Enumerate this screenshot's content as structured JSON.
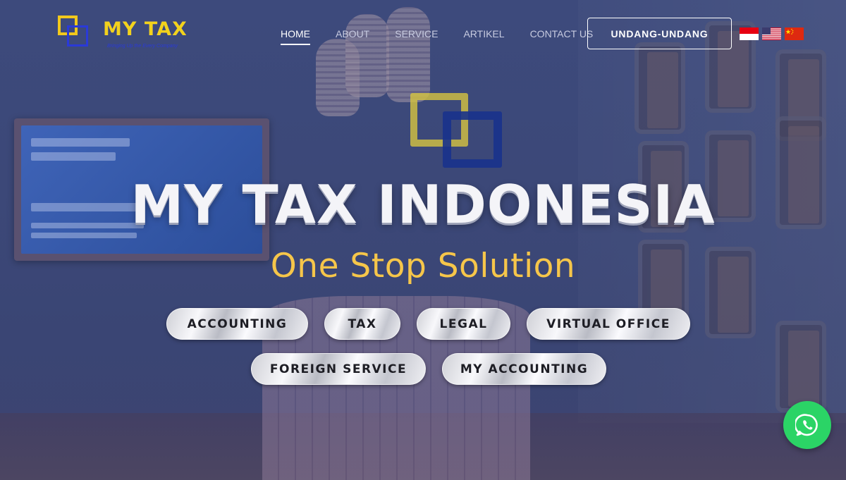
{
  "brand": {
    "name": "MY TAX",
    "tagline": "Bringing Up the Every Company",
    "colors": {
      "yellow": "#f2c81c",
      "blue": "#2a3ad8"
    }
  },
  "nav": {
    "items": [
      {
        "label": "HOME",
        "active": true
      },
      {
        "label": "ABOUT",
        "active": false
      },
      {
        "label": "SERVICE",
        "active": false
      },
      {
        "label": "ARTIKEL",
        "active": false
      },
      {
        "label": "CONTACT US",
        "active": false
      }
    ],
    "cta_label": "UNDANG-UNDANG",
    "languages": [
      "flag-indonesia-icon",
      "flag-usa-icon",
      "flag-china-icon"
    ]
  },
  "hero": {
    "title": "MY TAX INDONESIA",
    "subtitle": "One Stop Solution",
    "subtitle_color": "#f6c64a",
    "services_row1": [
      "ACCOUNTING",
      "TAX",
      "LEGAL",
      "VIRTUAL OFFICE"
    ],
    "services_row2": [
      "FOREIGN SERVICE",
      "MY ACCOUNTING"
    ]
  },
  "whatsapp": {
    "icon": "whatsapp-icon",
    "color": "#2bd466"
  }
}
